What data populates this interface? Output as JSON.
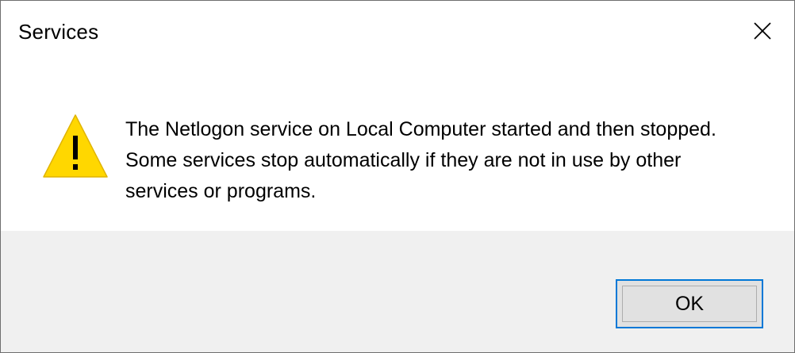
{
  "window": {
    "title": "Services",
    "close_icon": "close-icon"
  },
  "message": {
    "icon": "warning-icon",
    "lines": [
      "The Netlogon service on Local Computer started and then stopped.",
      "Some services stop automatically if they are not in use by other",
      "services or programs."
    ]
  },
  "buttons": {
    "ok_label": "OK"
  },
  "colors": {
    "warning_fill": "#ffd700",
    "focus_border": "#0078d7",
    "footer_bg": "#f0f0f0"
  }
}
